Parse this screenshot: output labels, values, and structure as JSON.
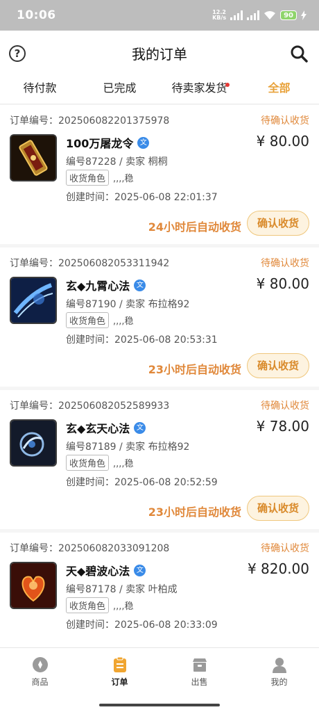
{
  "status_bar": {
    "time": "10:06",
    "speed_value": "12.2",
    "speed_unit": "KB/s",
    "battery": "90"
  },
  "header": {
    "title": "我的订单",
    "help_icon": "question-circle-icon",
    "search_icon": "search-icon"
  },
  "tabs": [
    {
      "label": "待付款",
      "active": false,
      "dot": false
    },
    {
      "label": "已完成",
      "active": false,
      "dot": false
    },
    {
      "label": "待卖家发货",
      "active": false,
      "dot": true
    },
    {
      "label": "全部",
      "active": true,
      "dot": false
    }
  ],
  "orders": [
    {
      "order_label": "订单编号：",
      "order_no": "202506082201375978",
      "status": "待确认收货",
      "name": "100万屠龙令",
      "price": "¥ 80.00",
      "meta": "编号87228 / 卖家 桐桐",
      "role_badge": "收货角色",
      "role_name": ",,,,稳",
      "created": "创建时间：2025-06-08 22:01:37",
      "auto": "24小时后自动收货",
      "button": "确认收货"
    },
    {
      "order_label": "订单编号：",
      "order_no": "202506082053311942",
      "status": "待确认收货",
      "name": "玄◆九霄心法",
      "price": "¥ 80.00",
      "meta": "编号87190 / 卖家 布拉格92",
      "role_badge": "收货角色",
      "role_name": ",,,,稳",
      "created": "创建时间：2025-06-08 20:53:31",
      "auto": "23小时后自动收货",
      "button": "确认收货"
    },
    {
      "order_label": "订单编号：",
      "order_no": "202506082052589933",
      "status": "待确认收货",
      "name": "玄◆玄天心法",
      "price": "¥ 78.00",
      "meta": "编号87189 / 卖家 布拉格92",
      "role_badge": "收货角色",
      "role_name": ",,,,稳",
      "created": "创建时间：2025-06-08 20:52:59",
      "auto": "23小时后自动收货",
      "button": "确认收货"
    },
    {
      "order_label": "订单编号：",
      "order_no": "202506082033091208",
      "status": "待确认收货",
      "name": "天◆碧波心法",
      "price": "¥ 820.00",
      "meta": "编号87178 / 卖家 叶柏成",
      "role_badge": "收货角色",
      "role_name": ",,,,稳",
      "created": "创建时间：2025-06-08 20:33:09",
      "auto": "",
      "button": ""
    }
  ],
  "bottom_nav": [
    {
      "label": "商品",
      "icon": "goods-icon",
      "active": false
    },
    {
      "label": "订单",
      "icon": "order-icon",
      "active": true
    },
    {
      "label": "出售",
      "icon": "sell-icon",
      "active": false
    },
    {
      "label": "我的",
      "icon": "profile-icon",
      "active": false
    }
  ],
  "colors": {
    "accent": "#e8a23a",
    "status": "#e0883a",
    "verify_badge": "#3a8be8"
  }
}
